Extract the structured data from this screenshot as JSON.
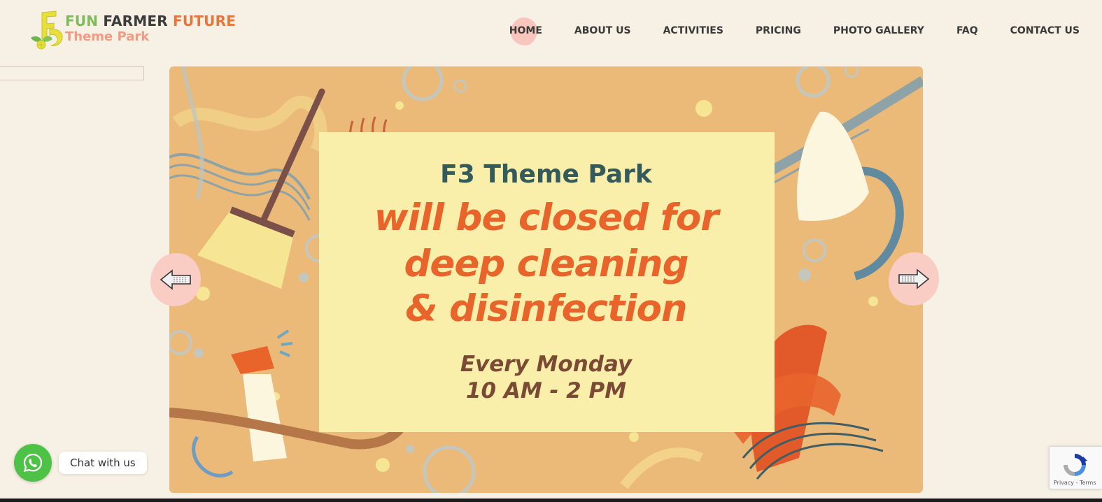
{
  "logo": {
    "word_fun": "FUN",
    "word_farmer": "FARMER",
    "word_future": "FUTURE",
    "subtitle": "Theme Park",
    "colors": {
      "fun": "#7dbb5b",
      "farmer": "#3b3b3b",
      "future": "#e8763b",
      "subtitle": "#f29b84",
      "mark": "#e8e03a"
    }
  },
  "nav": {
    "items": [
      {
        "label": "HOME",
        "active": true
      },
      {
        "label": "ABOUT US"
      },
      {
        "label": "ACTIVITIES"
      },
      {
        "label": "PRICING"
      },
      {
        "label": "PHOTO GALLERY"
      },
      {
        "label": "FAQ"
      },
      {
        "label": "CONTACT US"
      }
    ]
  },
  "search": {
    "value": "",
    "placeholder": ""
  },
  "slide": {
    "park_name": "F3 Theme Park",
    "headline_line1": "will be closed for",
    "headline_line2": "deep cleaning",
    "headline_line3": "& disinfection",
    "schedule_day": "Every Monday",
    "schedule_time": "10 AM - 2 PM",
    "colors": {
      "background": "#ebb978",
      "panel": "#f9efaa",
      "park_name": "#355a5c",
      "headline": "#e8642b",
      "schedule": "#7b4a34"
    },
    "controls": {
      "prev_icon": "arrow-left-icon",
      "next_icon": "arrow-right-icon"
    }
  },
  "chat": {
    "label": "Chat with us",
    "icon": "whatsapp-icon",
    "color": "#4dc247"
  },
  "recaptcha": {
    "text": "Privacy - Terms",
    "icon": "recaptcha-icon"
  }
}
